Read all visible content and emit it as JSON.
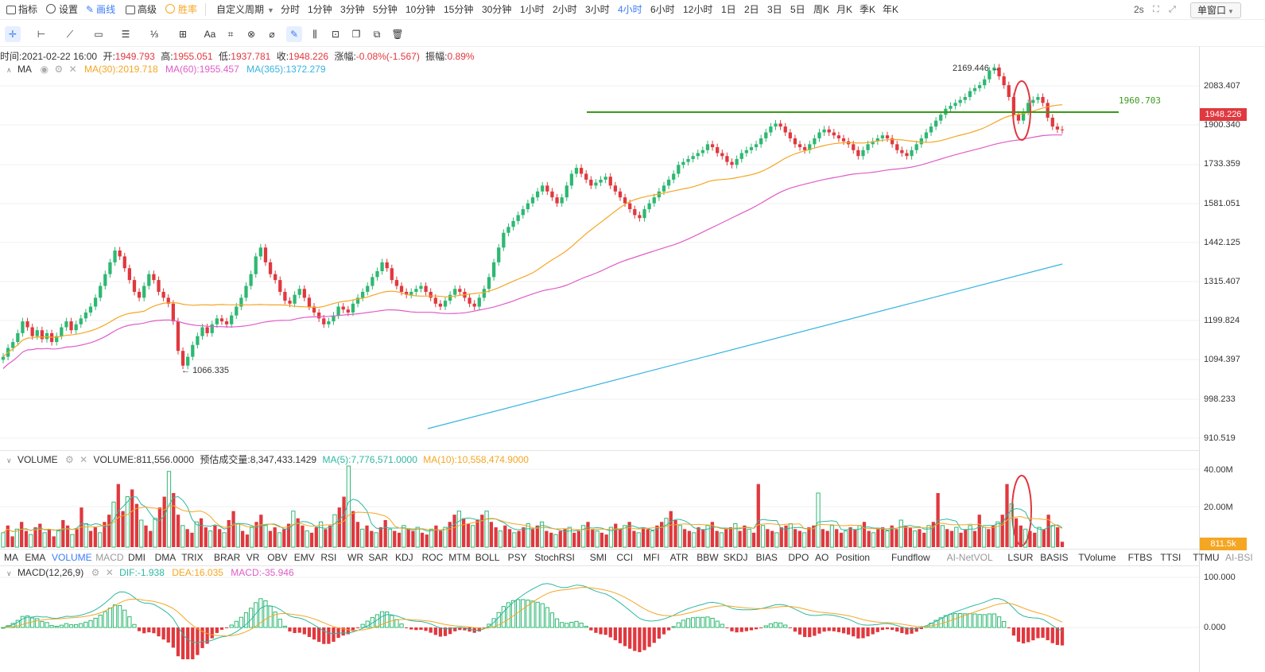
{
  "toolbar": {
    "indicator": "指标",
    "settings": "设置",
    "draw": "画线",
    "advanced": "高级",
    "winrate": "胜率",
    "custom_period": "自定义周期",
    "periods": [
      "分时",
      "1分钟",
      "3分钟",
      "5分钟",
      "10分钟",
      "15分钟",
      "30分钟",
      "1小时",
      "2小时",
      "3小时",
      "4小时",
      "6小时",
      "12小时",
      "1日",
      "2日",
      "3日",
      "5日",
      "周K",
      "月K",
      "季K",
      "年K"
    ],
    "active_period": "4小时",
    "refresh": "2s",
    "window_mode": "单窗口"
  },
  "draw_tools": {
    "text_tool": "Aa"
  },
  "ohlc": {
    "time_label": "时间:",
    "time": "2021-02-22 16:00",
    "open_label": "开:",
    "open": "1949.793",
    "high_label": "高:",
    "high": "1955.051",
    "low_label": "低:",
    "low": "1937.781",
    "close_label": "收:",
    "close": "1948.226",
    "change_label": "涨幅:",
    "change": "-0.08%(-1.567)",
    "amp_label": "振幅:",
    "amplitude": "0.89%"
  },
  "ma": {
    "name": "MA",
    "ma30": "MA(30):2019.718",
    "ma60": "MA(60):1955.457",
    "ma365": "MA(365):1372.279"
  },
  "price_axis": [
    "2083.407",
    "1900.340",
    "1733.359",
    "1581.051",
    "1442.125",
    "1315.407",
    "1199.824",
    "1094.397",
    "998.233",
    "910.519"
  ],
  "current_price": "1948.226",
  "hline_price": "1960.703",
  "annotations": {
    "high_mark": "2169.446",
    "low_mark": "1066.335"
  },
  "volume": {
    "name": "VOLUME",
    "value": "VOLUME:811,556.0000",
    "est": "预估成交量:8,347,433.1429",
    "ma5": "MA(5):7,776,571.0000",
    "ma10": "MA(10):10,558,474.9000",
    "axis": [
      "40.00M",
      "20.00M"
    ],
    "current": "811.5k"
  },
  "indicator_tabs": [
    "MA",
    "EMA",
    "VOLUME",
    "MACD",
    "DMI",
    "DMA",
    "TRIX",
    "BRAR",
    "VR",
    "OBV",
    "EMV",
    "RSI",
    "WR",
    "SAR",
    "KDJ",
    "ROC",
    "MTM",
    "BOLL",
    "PSY",
    "StochRSI",
    "SMI",
    "CCI",
    "MFI",
    "ATR",
    "BBW",
    "SKDJ",
    "BIAS",
    "DPO",
    "AO",
    "Position",
    "Fundflow",
    "AI-NetVOL",
    "LSUR",
    "BASIS",
    "TVolume",
    "FTBS",
    "TTSI",
    "TTMU",
    "AI-BSI"
  ],
  "active_indicator": "VOLUME",
  "macd": {
    "name": "MACD(12,26,9)",
    "dif": "DIF:-1.938",
    "dea": "DEA:16.035",
    "macd": "MACD:-35.946",
    "axis": [
      "100.000",
      "0.000"
    ]
  },
  "colors": {
    "up": "#2eb872",
    "down": "#e0383e",
    "ma30": "#f5a623",
    "ma60": "#e05cc8",
    "ma365": "#36b3e0",
    "hline": "#3a9a1a",
    "accent": "#3b7bf6",
    "annot": "#e0383e"
  },
  "chart_data": {
    "type": "candlestick",
    "price_range": [
      880,
      2200
    ],
    "closes": [
      1180,
      1210,
      1230,
      1260,
      1300,
      1280,
      1250,
      1270,
      1240,
      1260,
      1230,
      1250,
      1280,
      1300,
      1270,
      1290,
      1310,
      1330,
      1350,
      1380,
      1420,
      1460,
      1500,
      1540,
      1520,
      1480,
      1440,
      1400,
      1380,
      1420,
      1460,
      1440,
      1400,
      1380,
      1360,
      1300,
      1200,
      1150,
      1180,
      1220,
      1250,
      1280,
      1260,
      1290,
      1310,
      1300,
      1290,
      1320,
      1350,
      1380,
      1420,
      1460,
      1520,
      1550,
      1500,
      1460,
      1440,
      1400,
      1370,
      1360,
      1390,
      1410,
      1380,
      1350,
      1330,
      1310,
      1290,
      1300,
      1320,
      1350,
      1340,
      1330,
      1360,
      1380,
      1400,
      1420,
      1450,
      1470,
      1500,
      1480,
      1440,
      1420,
      1400,
      1390,
      1400,
      1410,
      1420,
      1400,
      1380,
      1360,
      1350,
      1370,
      1390,
      1410,
      1400,
      1380,
      1360,
      1350,
      1380,
      1410,
      1450,
      1500,
      1550,
      1600,
      1620,
      1640,
      1660,
      1680,
      1700,
      1720,
      1740,
      1760,
      1740,
      1720,
      1700,
      1720,
      1760,
      1800,
      1820,
      1800,
      1780,
      1760,
      1770,
      1780,
      1790,
      1760,
      1740,
      1720,
      1700,
      1680,
      1660,
      1650,
      1680,
      1700,
      1720,
      1740,
      1760,
      1780,
      1800,
      1830,
      1840,
      1850,
      1860,
      1870,
      1880,
      1900,
      1890,
      1870,
      1860,
      1840,
      1830,
      1850,
      1870,
      1880,
      1890,
      1900,
      1920,
      1940,
      1960,
      1970,
      1960,
      1940,
      1920,
      1900,
      1890,
      1880,
      1900,
      1920,
      1940,
      1950,
      1940,
      1930,
      1920,
      1910,
      1900,
      1880,
      1860,
      1880,
      1900,
      1910,
      1920,
      1930,
      1920,
      1900,
      1880,
      1870,
      1860,
      1880,
      1900,
      1920,
      1940,
      1960,
      1980,
      2000,
      2020,
      2030,
      2040,
      2050,
      2060,
      2080,
      2090,
      2100,
      2120,
      2150,
      2160,
      2130,
      2100,
      2060,
      2000,
      1980,
      2010,
      2040,
      2050,
      2060,
      2040,
      1990,
      1960,
      1950,
      1948
    ]
  },
  "volume_data": {
    "values": [
      8,
      12,
      6,
      10,
      14,
      9,
      7,
      11,
      13,
      8,
      10,
      6,
      9,
      15,
      12,
      7,
      10,
      22,
      13,
      9,
      11,
      8,
      14,
      18,
      25,
      35,
      20,
      28,
      32,
      24,
      15,
      12,
      9,
      16,
      22,
      28,
      42,
      30,
      18,
      12,
      10,
      8,
      14,
      16,
      11,
      9,
      12,
      10,
      8,
      15,
      20,
      13,
      9,
      7,
      11,
      14,
      18,
      12,
      9,
      11,
      8,
      10,
      13,
      20,
      16,
      12,
      9,
      8,
      11,
      14,
      10,
      12,
      18,
      22,
      28,
      45,
      20,
      14,
      10,
      12,
      9,
      8,
      11,
      15,
      10,
      9,
      8,
      12,
      10,
      9,
      11,
      8,
      7,
      10,
      12,
      9,
      11,
      14,
      18,
      20,
      16,
      13,
      12,
      15,
      18,
      20,
      14,
      11,
      9,
      12,
      10,
      8,
      9,
      11,
      13,
      10,
      12,
      14,
      9,
      8,
      7,
      9,
      10,
      11,
      8,
      9,
      12,
      14,
      10,
      9,
      8,
      7,
      11,
      13,
      10,
      12,
      14,
      9,
      8,
      11,
      10,
      9,
      12,
      14,
      16,
      20,
      15,
      12,
      10,
      9,
      8,
      11,
      10,
      12,
      14,
      9,
      8,
      10,
      11,
      13,
      9,
      12,
      10,
      8,
      35,
      12,
      10,
      9,
      8,
      11,
      12,
      13,
      10,
      9,
      8,
      11,
      12,
      30,
      10,
      9,
      12,
      10,
      8,
      9,
      11,
      10,
      12,
      14,
      9,
      8,
      10,
      11,
      9,
      12,
      10,
      15,
      12,
      11,
      9,
      10,
      8,
      12,
      14,
      30,
      12,
      10,
      9,
      11,
      8,
      10,
      12,
      9,
      18,
      11,
      10,
      12,
      14,
      18,
      35,
      24,
      16,
      12,
      10,
      9,
      8,
      11,
      10,
      18,
      12,
      11,
      3
    ]
  }
}
